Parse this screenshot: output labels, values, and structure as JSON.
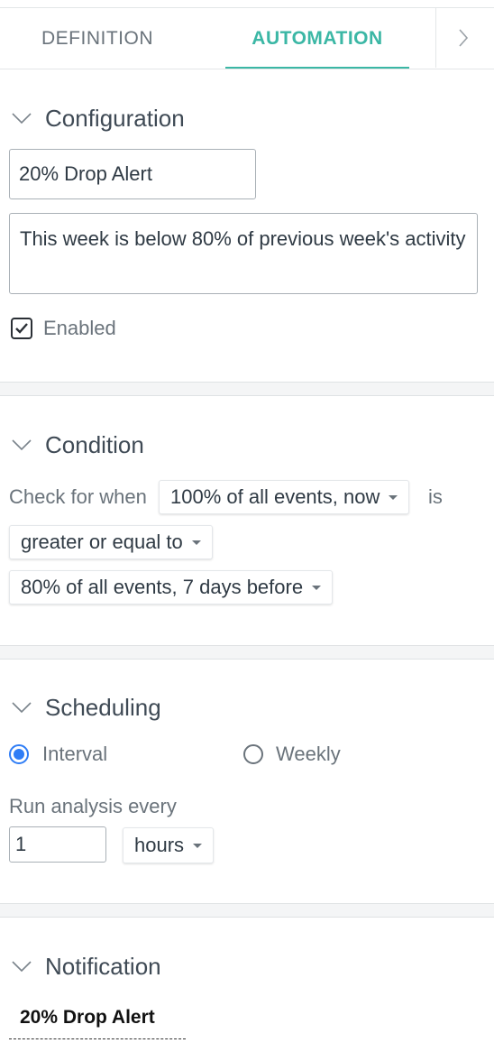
{
  "tabs": {
    "definition": "DEFINITION",
    "automation": "AUTOMATION"
  },
  "configuration": {
    "title": "Configuration",
    "name_value": "20% Drop Alert",
    "description_value": "This week is below 80% of previous week's activity",
    "enabled_label": "Enabled",
    "enabled": true
  },
  "condition": {
    "title": "Condition",
    "check_label": "Check for when",
    "left_operand": "100% of all events, now",
    "is_label": "is",
    "comparator": "greater or equal to",
    "right_operand": "80% of all events, 7 days before"
  },
  "scheduling": {
    "title": "Scheduling",
    "interval_label": "Interval",
    "weekly_label": "Weekly",
    "selected": "Interval",
    "run_label": "Run analysis every",
    "interval_value": "1",
    "unit": "hours"
  },
  "notification": {
    "title": "Notification",
    "name": "20% Drop Alert"
  },
  "colors": {
    "accent": "#3bb7a5",
    "radio": "#2f7df6"
  }
}
